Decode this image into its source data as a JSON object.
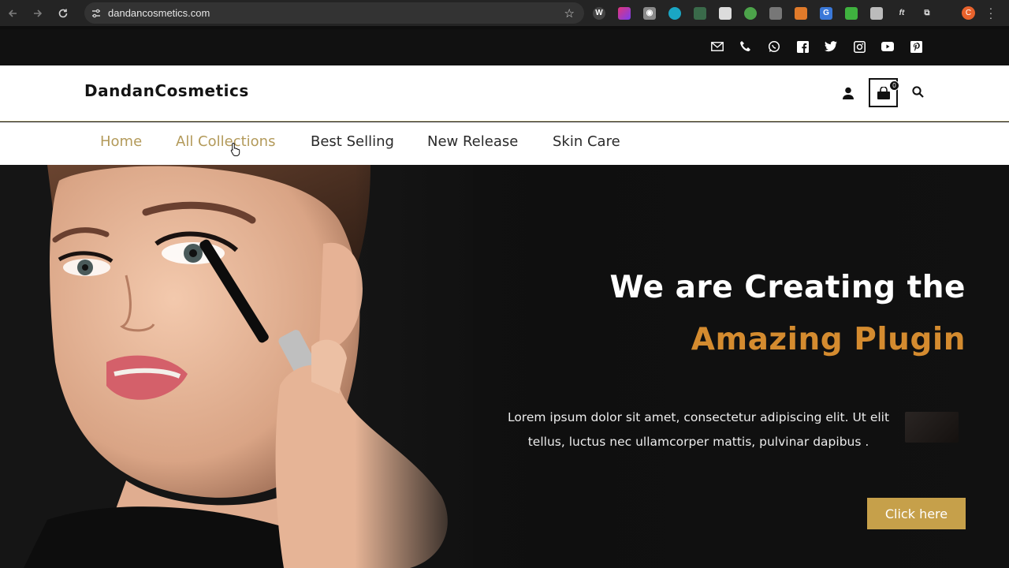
{
  "browser": {
    "url": "dandancosmetics.com",
    "profile_initial": "C",
    "extensions": [
      "extension-1",
      "extension-2",
      "camera",
      "extension-4",
      "extension-5",
      "extension-6",
      "extension-7",
      "extension-8",
      "extension-9",
      "translate",
      "extension-11",
      "extension-12",
      "extension-13",
      "puzzle"
    ]
  },
  "topbar": {
    "icons": [
      "email-icon",
      "phone-icon",
      "whatsapp-icon",
      "facebook-icon",
      "twitter-icon",
      "instagram-icon",
      "youtube-icon",
      "pinterest-icon"
    ]
  },
  "header": {
    "logo": "DandanCosmetics",
    "cart_count": "0"
  },
  "nav": {
    "items": [
      "Home",
      "All Collections",
      "Best Selling",
      "New Release",
      "Skin Care"
    ]
  },
  "hero": {
    "headline_line1": "We are Creating the",
    "headline_line2": "Amazing Plugin",
    "body": "Lorem ipsum dolor sit amet, consectetur adipiscing elit. Ut elit tellus, luctus nec ullamcorper mattis, pulvinar dapibus .",
    "cta_label": "Click here"
  },
  "colors": {
    "accent_gold": "#c6a04a",
    "headline_orange": "#d48b2f",
    "nav_active": "#b39a5a",
    "hero_background": "#111111"
  }
}
